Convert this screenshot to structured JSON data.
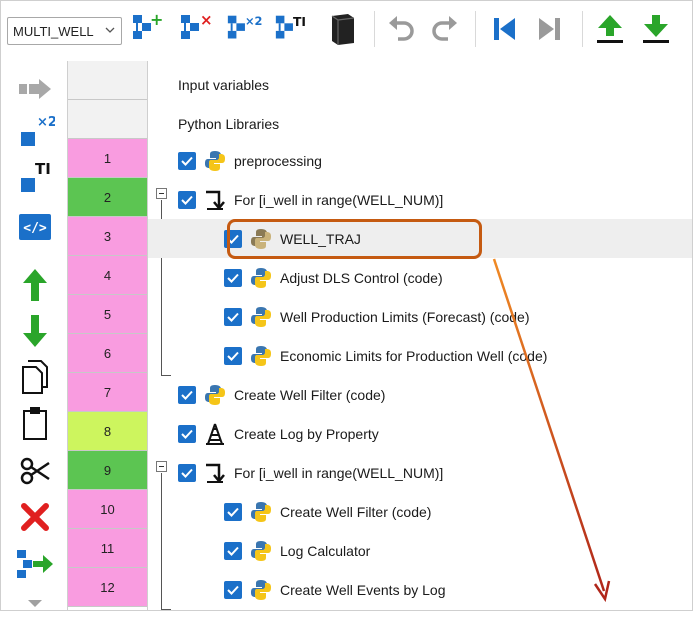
{
  "toolbar": {
    "combo_value": "MULTI_WELL",
    "buttons": [
      {
        "name": "add-step-icon",
        "badge": "+"
      },
      {
        "name": "delete-step-icon",
        "badge": "×"
      },
      {
        "name": "duplicate-step-icon",
        "badge": "×2"
      },
      {
        "name": "rename-step-icon",
        "badge": "TI"
      },
      {
        "name": "library-book-icon"
      },
      {
        "name": "undo-icon"
      },
      {
        "name": "redo-icon"
      },
      {
        "name": "first-step-icon"
      },
      {
        "name": "last-step-icon"
      },
      {
        "name": "move-up-icon"
      },
      {
        "name": "move-down-icon"
      }
    ],
    "badges": {
      "add": "+",
      "delete": "×",
      "duplicate": "×2",
      "rename": "TI"
    }
  },
  "leftbar": {
    "badges": {
      "duplicate": "×2",
      "rename": "TI",
      "code": "</>"
    }
  },
  "rows": {
    "header_rows": [
      "Input variables",
      "Python Libraries"
    ],
    "numbers": [
      "1",
      "2",
      "3",
      "4",
      "5",
      "6",
      "7",
      "8",
      "9",
      "10",
      "11",
      "12"
    ],
    "labels": [
      "preprocessing",
      "For [i_well in range(WELL_NUM)]",
      "WELL_TRAJ",
      "Adjust DLS Control (code)",
      "Well Production Limits (Forecast) (code)",
      "Economic Limits for Production Well (code)",
      "Create Well Filter (code)",
      "Create Log by Property",
      "For [i_well in range(WELL_NUM)]",
      "Create Well Filter (code)",
      "Log Calculator",
      "Create Well Events by Log"
    ]
  },
  "colors": {
    "accent_blue": "#1b70c9",
    "row_pink": "#f99ce0",
    "row_green": "#5cc552",
    "row_lime": "#cdf55e",
    "highlight_orange": "#c55a11",
    "arrow_start": "#f08a24",
    "arrow_end": "#b0261a"
  }
}
